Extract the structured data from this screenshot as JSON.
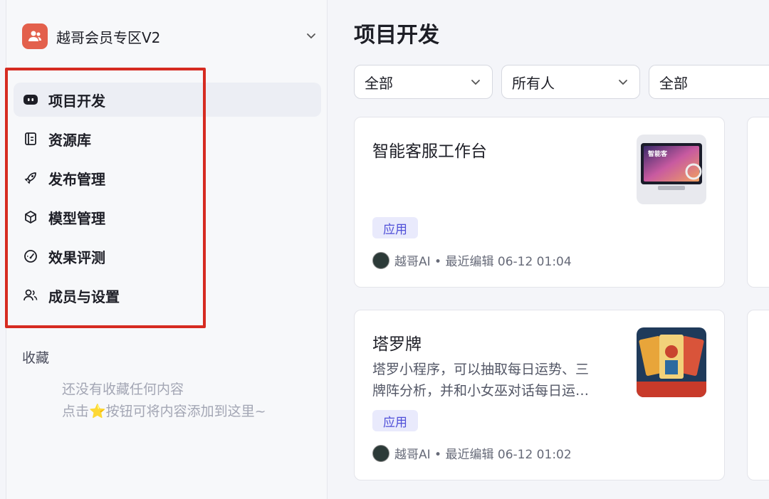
{
  "workspace": {
    "name": "越哥会员专区V2",
    "icon": "team-icon"
  },
  "nav": [
    {
      "label": "项目开发",
      "icon": "bot-icon",
      "active": true
    },
    {
      "label": "资源库",
      "icon": "library-icon"
    },
    {
      "label": "发布管理",
      "icon": "rocket-icon"
    },
    {
      "label": "模型管理",
      "icon": "model-cube-icon"
    },
    {
      "label": "效果评测",
      "icon": "gauge-icon"
    },
    {
      "label": "成员与设置",
      "icon": "members-icon"
    }
  ],
  "favorites": {
    "title": "收藏",
    "empty_line1": "还没有收藏任何内容",
    "empty_line2": "点击⭐按钮可将内容添加到这里~"
  },
  "main": {
    "title": "项目开发",
    "filters": [
      {
        "value": "全部"
      },
      {
        "value": "所有人"
      },
      {
        "value": "全部"
      }
    ],
    "cards": [
      {
        "title": "智能客服工作台",
        "description": "",
        "tag": "应用",
        "author": "越哥AI",
        "meta": "越哥AI • 最近编辑 06-12 01:04",
        "thumb_text": "智能客"
      },
      {
        "title": "塔罗牌",
        "description_line1": "塔罗小程序，可以抽取每日运势、三",
        "description_line2": "牌阵分析，并和小女巫对话每日运…",
        "tag": "应用",
        "author": "越哥AI",
        "meta": "越哥AI • 最近编辑 06-12 01:02"
      }
    ]
  },
  "colors": {
    "accent": "#4f4fd8",
    "highlight": "#d62b21",
    "workspace_avatar": "#e3604c"
  }
}
